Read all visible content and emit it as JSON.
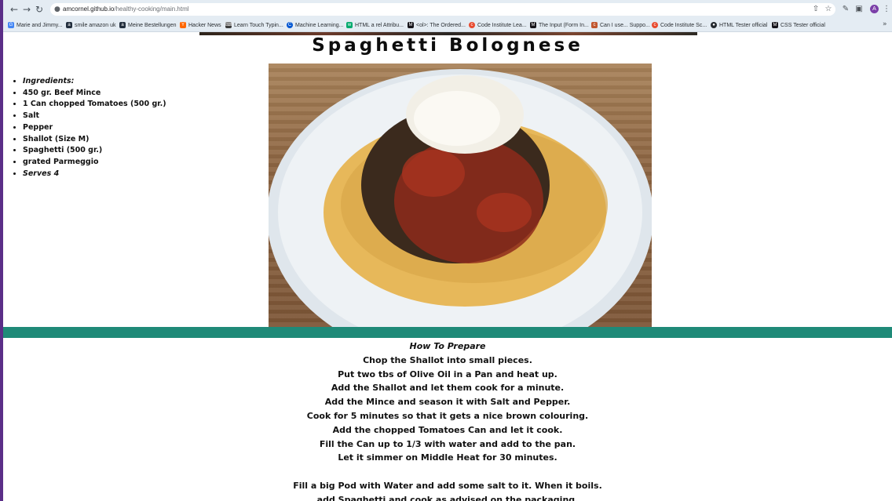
{
  "browser": {
    "url_host": "amcornel.github.io",
    "url_path": "/healthy-cooking/main.html",
    "profile_initial": "A"
  },
  "bookmarks": [
    {
      "label": "Marie and Jimmy...",
      "icon": "google-icon",
      "color": "#4285f4"
    },
    {
      "label": "smile amazon uk",
      "icon": "amazon-icon",
      "color": "#232f3e"
    },
    {
      "label": "Meine Bestellungen",
      "icon": "amazon-icon",
      "color": "#232f3e"
    },
    {
      "label": "Hacker News",
      "icon": "ycombinator-icon",
      "color": "#ff6600"
    },
    {
      "label": "Learn Touch Typin...",
      "icon": "keyboard-icon",
      "color": "#3a3a3a"
    },
    {
      "label": "Machine Learning...",
      "icon": "coursera-icon",
      "color": "#0056d2"
    },
    {
      "label": "HTML a rel Attribu...",
      "icon": "w3schools-icon",
      "color": "#04aa6d"
    },
    {
      "label": "<ol>: The Ordered...",
      "icon": "mdn-icon",
      "color": "#15141a"
    },
    {
      "label": "Code Institute Lea...",
      "icon": "code-institute-icon",
      "color": "#e84a2f"
    },
    {
      "label": "The Input (Form In...",
      "icon": "mdn-icon",
      "color": "#15141a"
    },
    {
      "label": "Can I use... Suppo...",
      "icon": "caniuse-icon",
      "color": "#c0562f"
    },
    {
      "label": "Code Institute Sc...",
      "icon": "code-institute-icon",
      "color": "#e84a2f"
    },
    {
      "label": "HTML Tester official",
      "icon": "github-icon",
      "color": "#24292f"
    },
    {
      "label": "CSS Tester official",
      "icon": "mdn-icon",
      "color": "#15141a"
    }
  ],
  "page": {
    "title": "Spaghetti Bolognese",
    "ingredients": [
      {
        "text": "Ingredients:",
        "italic": true
      },
      {
        "text": "450 gr. Beef Mince",
        "italic": false
      },
      {
        "text": "1 Can chopped Tomatoes (500 gr.)",
        "italic": false
      },
      {
        "text": "Salt",
        "italic": false
      },
      {
        "text": "Pepper",
        "italic": false
      },
      {
        "text": "Shallot (Size M)",
        "italic": false
      },
      {
        "text": "Spaghetti (500 gr.)",
        "italic": false
      },
      {
        "text": "grated Parmeggio",
        "italic": false
      },
      {
        "text": "Serves 4",
        "italic": true
      }
    ],
    "how_to_title": "How To Prepare",
    "steps": [
      "Chop the Shallot into small pieces.",
      "Put two tbs of Olive Oil in a Pan and heat up.",
      "Add the Shallot and let them cook for a minute.",
      "Add the Mince and season it with Salt and Pepper.",
      "Cook for 5 minutes so that it gets a nice brown colouring.",
      "Add the chopped Tomatoes Can and let it cook.",
      "Fill the Can up to 1/3 with water and add to the pan.",
      "Let it simmer on Middle Heat for 30 minutes.",
      "",
      "Fill a big Pod with Water and add some salt to it. When it boils.",
      "add Spaghetti and cook as advised on the packaging."
    ],
    "colors": {
      "band": "#1f8a78",
      "text": "#111111"
    }
  }
}
